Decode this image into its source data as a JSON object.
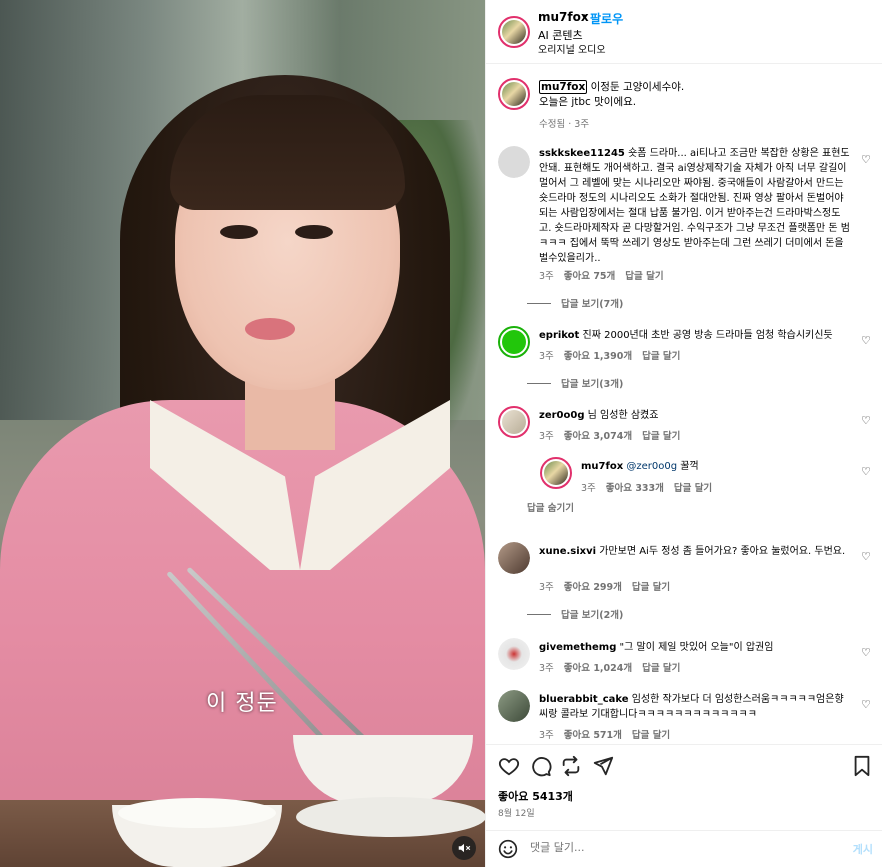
{
  "video": {
    "subtitle": "이 정둔"
  },
  "header": {
    "username": "mu7fox",
    "dot": "•",
    "follow_label": "팔로우",
    "subtitle": "AI 콘텐츠",
    "audio": "오리지널 오디오"
  },
  "caption": {
    "username": "mu7fox",
    "text_line1": "이정둔 고양이세수야.",
    "text_line2": "오늘은 jtbc 맛이에요.",
    "meta": "수정됨 · 3주"
  },
  "comments": [
    {
      "username": "sskkskee11245",
      "text": "숏폼 드라마... ai티나고 조금만 복잡한 상황은 표현도 안돼. 표현해도 개어색하고. 결국 ai영상제작기술 자체가 아직 너무 갈길이 멀어서 그 레벨에 맞는 시나리오만 짜야됨. 중국애들이 사람갈아서 만드는 숏드라마 정도의 시나리오도 소화가 절대안됨. 진짜 영상 팔아서 돈벌어야되는 사람입장에서는 절대 납품 불가임. 이거 받아주는건 드라마박스정도고. 숏드라마제작자 곧 다망할거임. 수익구조가 그냥 무조건 플랫폼만 돈 범 ㅋㅋㅋ 집에서 뚝딱 쓰레기 영상도 받아주는데 그런 쓰레기 더미에서 돈을 벌수있을리가..",
      "time": "3주",
      "likes": "좋아요 75개",
      "reply": "답글 달기",
      "view_replies": "답글 보기(7개)"
    },
    {
      "username": "eprikot",
      "text": "진짜 2000년대 초반 공영 방송 드라마들 엄청 학습시키신듯",
      "time": "3주",
      "likes": "좋아요 1,390개",
      "reply": "답글 달기",
      "view_replies": "답글 보기(3개)"
    },
    {
      "username": "zer0o0g",
      "text": "님 임성한 삼켰죠",
      "time": "3주",
      "likes": "좋아요 3,074개",
      "reply": "답글 달기"
    },
    {
      "username": "xune.sixvi",
      "text": "가만보면 Ai두 정성 좀 들어가요? 좋아요 눌렀어요. 두번요.",
      "time": "3주",
      "likes": "좋아요 299개",
      "reply": "답글 달기",
      "view_replies": "답글 보기(2개)"
    },
    {
      "username": "givemethemg",
      "text": "\"그 말이 제일 맛있어 오늘\"이 압권임",
      "time": "3주",
      "likes": "좋아요 1,024개",
      "reply": "답글 달기"
    },
    {
      "username": "bluerabbit_cake",
      "text": "임성한 작가보다 더 임성한스러움ㅋㅋㅋㅋㅋ엄은향씨랑 콜라보 기대합니다ㅋㅋㅋㅋㅋㅋㅋㅋㅋㅋㅋㅋㅋ",
      "time": "3주",
      "likes": "좋아요 571개",
      "reply": "답글 달기"
    }
  ],
  "nested_reply": {
    "username": "mu7fox",
    "mention": "@zer0o0g",
    "text": "꿀꺽",
    "time": "3주",
    "likes": "좋아요 333개",
    "reply": "답글 달기",
    "hide_replies": "답글 숨기기"
  },
  "actions": {
    "likes": "좋아요 5413개",
    "date": "8월 12일"
  },
  "composer": {
    "placeholder": "댓글 달기...",
    "post_label": "게시"
  },
  "icons": {
    "heart": "heart-icon",
    "comment": "comment-icon",
    "repost": "repost-icon",
    "share": "share-icon",
    "save": "bookmark-icon",
    "emoji": "emoji-icon",
    "mute": "mute-icon"
  }
}
